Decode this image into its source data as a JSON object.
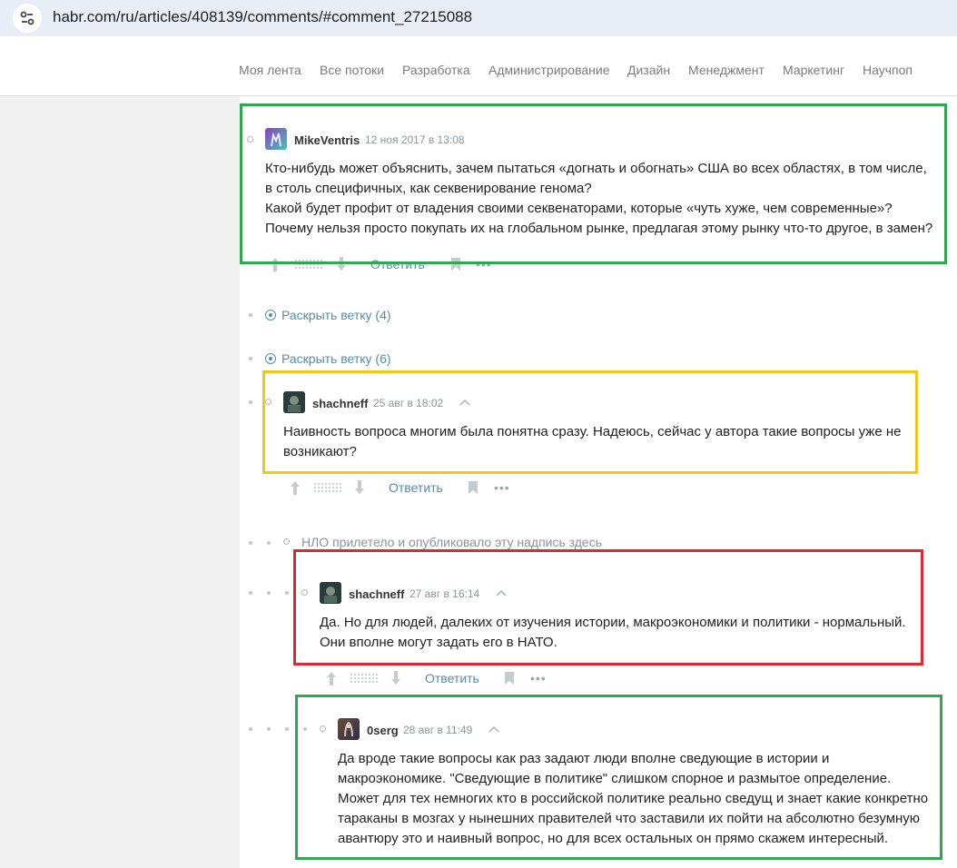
{
  "browser": {
    "url": "habr.com/ru/articles/408139/comments/#comment_27215088"
  },
  "nav": {
    "items": [
      "Моя лента",
      "Все потоки",
      "Разработка",
      "Администрирование",
      "Дизайн",
      "Менеджмент",
      "Маркетинг",
      "Научпоп"
    ]
  },
  "comments": [
    {
      "username": "MikeVentris",
      "time": "12 ноя 2017 в 13:08",
      "lines": [
        "Кто-нибудь может объяснить, зачем пытаться «догнать и обогнать» США во всех областях, в том числе,",
        "в столь специфичных, как секвенирование генома?",
        "Какой будет профит от владения своими секвенаторами, которые «чуть хуже, чем современные»?",
        "Почему нельзя просто покупать их на глобальном рынке, предлагая этому рынку что-то другое, в замен?"
      ],
      "reply_label": "Ответить"
    },
    {
      "username": "shachneff",
      "time": "25 авг в 18:02",
      "lines": [
        "Наивность вопроса многим была понятна сразу. Надеюсь, сейчас у автора такие вопросы уже не",
        "возникают?"
      ],
      "reply_label": "Ответить"
    },
    {
      "username": "shachneff",
      "time": "27 авг в 16:14",
      "lines": [
        "Да. Но для людей, далеких от изучения истории, макроэкономики и политики - нормальный.",
        "Они вполне могут задать его в НАТО."
      ],
      "reply_label": "Ответить"
    },
    {
      "username": "0serg",
      "time": "28 авг в 11:49",
      "lines": [
        "Да вроде такие вопросы как раз задают люди вполне сведующие в истории и",
        "макроэкономике. \"Сведующие в политике\" слишком спорное и размытое определение.",
        "Может для тех немногих кто в российской политике реально сведущ и знает какие конкретно",
        "тараканы в мозгах у нынешних правителей что заставили их пойти на абсолютно безумную",
        "авантюру это и наивный вопрос, но для всех остальных он прямо скажем интересный."
      ]
    }
  ],
  "expand_branches": [
    "Раскрыть ветку (4)",
    "Раскрыть ветку (6)"
  ],
  "ufo_notice": "НЛО прилетело и опубликовало эту надпись здесь",
  "highlight_colors": {
    "green": "#2fa84f",
    "yellow": "#f5c518",
    "red": "#e0282e"
  }
}
